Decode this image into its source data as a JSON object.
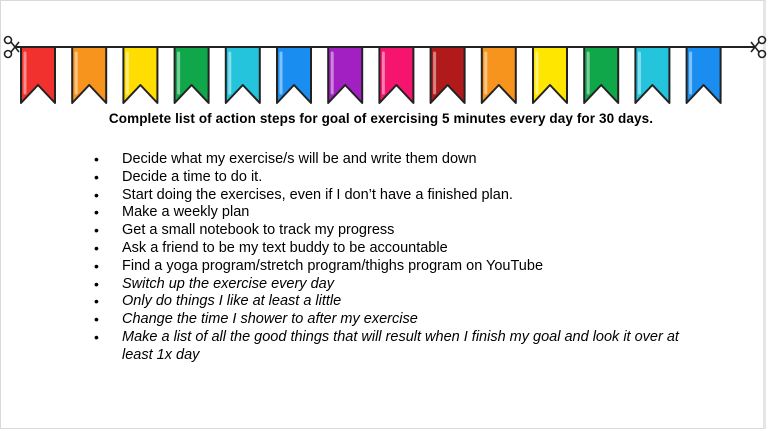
{
  "bunting": {
    "flag_colors": [
      "#f0312e",
      "#f7941d",
      "#ffdd00",
      "#10a64a",
      "#24c4dc",
      "#1a8ef0",
      "#a21fc2",
      "#f5146e",
      "#b01a1a",
      "#f7941d",
      "#ffe600",
      "#10a64a",
      "#24c4dc",
      "#1a8ef0"
    ],
    "left_icon": "scissors-icon",
    "right_icon": "scissors-icon"
  },
  "title": "Complete list of action steps for goal of exercising 5 minutes every day for 30 days.",
  "bullet_glyph": "•",
  "steps": [
    {
      "text": "Decide what my exercise/s will be and write them down",
      "italic": false
    },
    {
      "text": "Decide a time to do it.",
      "italic": false
    },
    {
      "text": "Start doing the exercises, even if I don’t have a finished plan.",
      "italic": false
    },
    {
      "text": "Make a weekly plan",
      "italic": false
    },
    {
      "text": "Get a small notebook to track my progress",
      "italic": false
    },
    {
      "text": "Ask a friend to be my text buddy to be accountable",
      "italic": false
    },
    {
      "text": "Find a yoga program/stretch program/thighs program on YouTube",
      "italic": false
    },
    {
      "text": "Switch up the exercise every day",
      "italic": true
    },
    {
      "text": "Only do things I like at least a little",
      "italic": true
    },
    {
      "text": "Change the time I shower to after my exercise",
      "italic": true
    },
    {
      "text": "Make a list of all the good things that will result when I finish my goal and look it over at least 1x day",
      "italic": true
    }
  ]
}
